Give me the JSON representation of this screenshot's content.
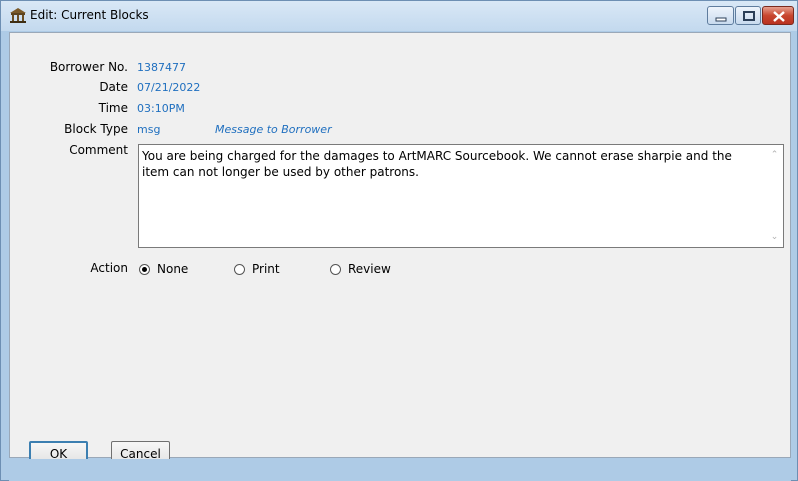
{
  "window": {
    "title": "Edit: Current Blocks",
    "icon": "library-building-icon",
    "controls": {
      "minimize": "minimize-icon",
      "maximize": "maximize-icon",
      "close": "close-icon"
    }
  },
  "form": {
    "borrower_no_label": "Borrower No.",
    "borrower_no": "1387477",
    "date_label": "Date",
    "date": "07/21/2022",
    "time_label": "Time",
    "time": "03:10PM",
    "block_type_label": "Block Type",
    "block_type_code": "msg",
    "block_type_desc": "Message to Borrower",
    "comment_label": "Comment",
    "comment": "You are being charged for the damages to ArtMARC Sourcebook. We cannot erase sharpie and the item can not longer be used by other patrons.",
    "action_label": "Action",
    "actions": [
      {
        "label": "None",
        "checked": true
      },
      {
        "label": "Print",
        "checked": false
      },
      {
        "label": "Review",
        "checked": false
      }
    ]
  },
  "buttons": {
    "ok": "OK",
    "cancel": "Cancel"
  },
  "colors": {
    "value_text": "#1f6fbf",
    "frame": "#aecbe6",
    "panel": "#f0f0f0"
  }
}
